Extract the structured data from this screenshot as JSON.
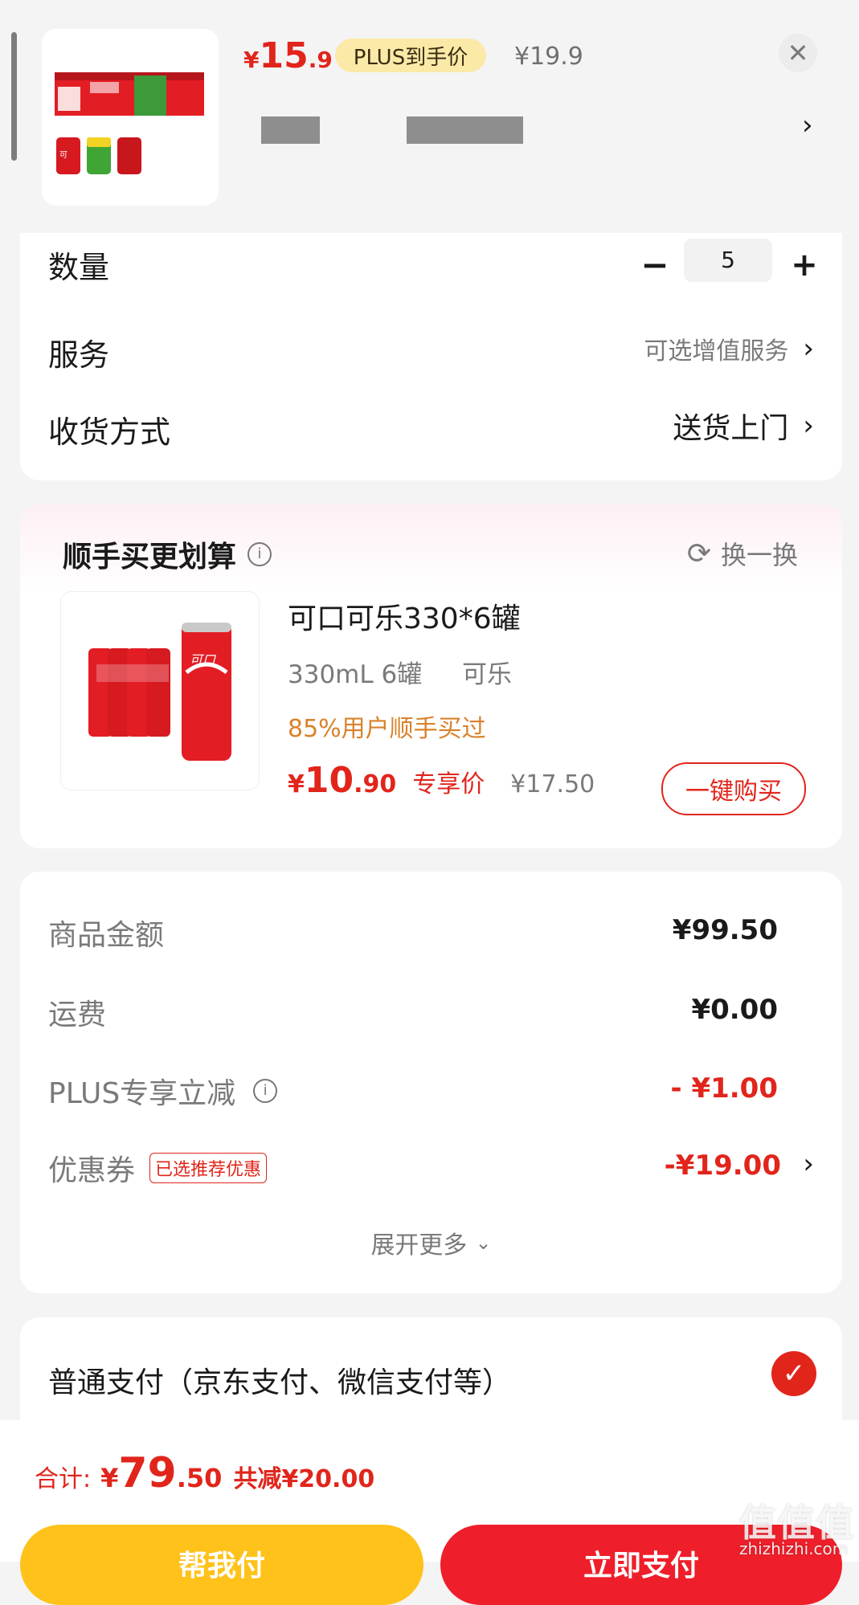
{
  "product": {
    "price_currency": "¥",
    "price_int": "15",
    "price_dec": ".9",
    "plus_badge": "PLUS到手价",
    "original_price": "¥19.9"
  },
  "options": {
    "quantity_label": "数量",
    "quantity_value": "5",
    "minus": "−",
    "plus": "+",
    "service_label": "服务",
    "service_value": "可选增值服务",
    "delivery_label": "收货方式",
    "delivery_value": "送货上门"
  },
  "upsell": {
    "title": "顺手买更划算",
    "swap_label": "换一换",
    "item_name": "可口可乐330*6罐",
    "spec_size": "330mL 6罐",
    "spec_flavor": "可乐",
    "social_proof": "85%用户顺手买过",
    "price_currency": "¥",
    "price_int": "10",
    "price_dec": ".90",
    "price_tag": "专享价",
    "original_price": "¥17.50",
    "buy_button": "一键购买"
  },
  "summary": {
    "goods_label": "商品金额",
    "goods_value": "¥99.50",
    "shipping_label": "运费",
    "shipping_value": "¥0.00",
    "plus_discount_label": "PLUS专享立减",
    "plus_discount_value": "- ¥1.00",
    "coupon_label": "优惠券",
    "coupon_tag": "已选推荐优惠",
    "coupon_value": "-¥19.00",
    "expand_label": "展开更多"
  },
  "payment": {
    "method_label": "普通支付（京东支付、微信支付等）"
  },
  "footer": {
    "total_label": "合计:",
    "total_currency": "¥",
    "total_int": "79",
    "total_dec": ".50",
    "saved_label": "共减¥20.00",
    "friend_pay_button": "帮我付",
    "pay_button": "立即支付"
  },
  "watermark": {
    "logo_text": "值值值",
    "url": "zhizhizhi.com"
  },
  "colors": {
    "accent_red": "#e1251b",
    "plus_gold": "#fbe9a8",
    "orange_text": "#d9822b",
    "friend_pay_yellow": "#ffc21a"
  }
}
